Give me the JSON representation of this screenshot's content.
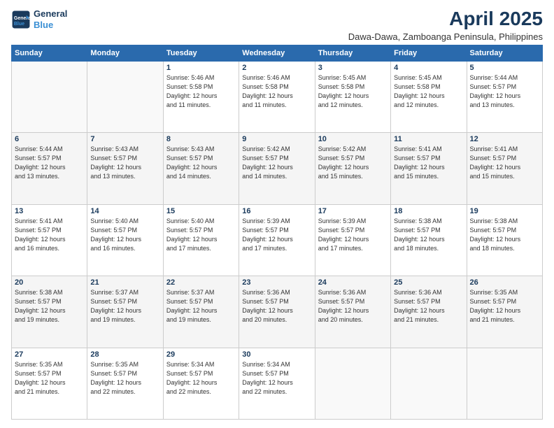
{
  "header": {
    "logo_line1": "General",
    "logo_line2": "Blue",
    "title": "April 2025",
    "subtitle": "Dawa-Dawa, Zamboanga Peninsula, Philippines"
  },
  "days_of_week": [
    "Sunday",
    "Monday",
    "Tuesday",
    "Wednesday",
    "Thursday",
    "Friday",
    "Saturday"
  ],
  "weeks": [
    [
      {
        "day": "",
        "info": ""
      },
      {
        "day": "",
        "info": ""
      },
      {
        "day": "1",
        "info": "Sunrise: 5:46 AM\nSunset: 5:58 PM\nDaylight: 12 hours\nand 11 minutes."
      },
      {
        "day": "2",
        "info": "Sunrise: 5:46 AM\nSunset: 5:58 PM\nDaylight: 12 hours\nand 11 minutes."
      },
      {
        "day": "3",
        "info": "Sunrise: 5:45 AM\nSunset: 5:58 PM\nDaylight: 12 hours\nand 12 minutes."
      },
      {
        "day": "4",
        "info": "Sunrise: 5:45 AM\nSunset: 5:58 PM\nDaylight: 12 hours\nand 12 minutes."
      },
      {
        "day": "5",
        "info": "Sunrise: 5:44 AM\nSunset: 5:57 PM\nDaylight: 12 hours\nand 13 minutes."
      }
    ],
    [
      {
        "day": "6",
        "info": "Sunrise: 5:44 AM\nSunset: 5:57 PM\nDaylight: 12 hours\nand 13 minutes."
      },
      {
        "day": "7",
        "info": "Sunrise: 5:43 AM\nSunset: 5:57 PM\nDaylight: 12 hours\nand 13 minutes."
      },
      {
        "day": "8",
        "info": "Sunrise: 5:43 AM\nSunset: 5:57 PM\nDaylight: 12 hours\nand 14 minutes."
      },
      {
        "day": "9",
        "info": "Sunrise: 5:42 AM\nSunset: 5:57 PM\nDaylight: 12 hours\nand 14 minutes."
      },
      {
        "day": "10",
        "info": "Sunrise: 5:42 AM\nSunset: 5:57 PM\nDaylight: 12 hours\nand 15 minutes."
      },
      {
        "day": "11",
        "info": "Sunrise: 5:41 AM\nSunset: 5:57 PM\nDaylight: 12 hours\nand 15 minutes."
      },
      {
        "day": "12",
        "info": "Sunrise: 5:41 AM\nSunset: 5:57 PM\nDaylight: 12 hours\nand 15 minutes."
      }
    ],
    [
      {
        "day": "13",
        "info": "Sunrise: 5:41 AM\nSunset: 5:57 PM\nDaylight: 12 hours\nand 16 minutes."
      },
      {
        "day": "14",
        "info": "Sunrise: 5:40 AM\nSunset: 5:57 PM\nDaylight: 12 hours\nand 16 minutes."
      },
      {
        "day": "15",
        "info": "Sunrise: 5:40 AM\nSunset: 5:57 PM\nDaylight: 12 hours\nand 17 minutes."
      },
      {
        "day": "16",
        "info": "Sunrise: 5:39 AM\nSunset: 5:57 PM\nDaylight: 12 hours\nand 17 minutes."
      },
      {
        "day": "17",
        "info": "Sunrise: 5:39 AM\nSunset: 5:57 PM\nDaylight: 12 hours\nand 17 minutes."
      },
      {
        "day": "18",
        "info": "Sunrise: 5:38 AM\nSunset: 5:57 PM\nDaylight: 12 hours\nand 18 minutes."
      },
      {
        "day": "19",
        "info": "Sunrise: 5:38 AM\nSunset: 5:57 PM\nDaylight: 12 hours\nand 18 minutes."
      }
    ],
    [
      {
        "day": "20",
        "info": "Sunrise: 5:38 AM\nSunset: 5:57 PM\nDaylight: 12 hours\nand 19 minutes."
      },
      {
        "day": "21",
        "info": "Sunrise: 5:37 AM\nSunset: 5:57 PM\nDaylight: 12 hours\nand 19 minutes."
      },
      {
        "day": "22",
        "info": "Sunrise: 5:37 AM\nSunset: 5:57 PM\nDaylight: 12 hours\nand 19 minutes."
      },
      {
        "day": "23",
        "info": "Sunrise: 5:36 AM\nSunset: 5:57 PM\nDaylight: 12 hours\nand 20 minutes."
      },
      {
        "day": "24",
        "info": "Sunrise: 5:36 AM\nSunset: 5:57 PM\nDaylight: 12 hours\nand 20 minutes."
      },
      {
        "day": "25",
        "info": "Sunrise: 5:36 AM\nSunset: 5:57 PM\nDaylight: 12 hours\nand 21 minutes."
      },
      {
        "day": "26",
        "info": "Sunrise: 5:35 AM\nSunset: 5:57 PM\nDaylight: 12 hours\nand 21 minutes."
      }
    ],
    [
      {
        "day": "27",
        "info": "Sunrise: 5:35 AM\nSunset: 5:57 PM\nDaylight: 12 hours\nand 21 minutes."
      },
      {
        "day": "28",
        "info": "Sunrise: 5:35 AM\nSunset: 5:57 PM\nDaylight: 12 hours\nand 22 minutes."
      },
      {
        "day": "29",
        "info": "Sunrise: 5:34 AM\nSunset: 5:57 PM\nDaylight: 12 hours\nand 22 minutes."
      },
      {
        "day": "30",
        "info": "Sunrise: 5:34 AM\nSunset: 5:57 PM\nDaylight: 12 hours\nand 22 minutes."
      },
      {
        "day": "",
        "info": ""
      },
      {
        "day": "",
        "info": ""
      },
      {
        "day": "",
        "info": ""
      }
    ]
  ]
}
